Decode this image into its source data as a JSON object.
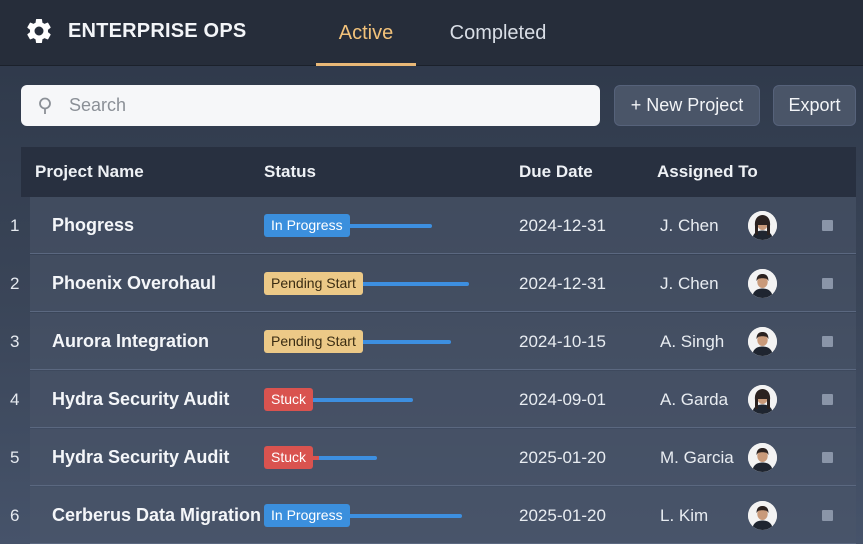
{
  "brand": {
    "title": "ENTERPRISE OPS",
    "icon": "gear-icon"
  },
  "tabs": [
    {
      "label": "Active",
      "active": true
    },
    {
      "label": "Completed",
      "active": false
    }
  ],
  "toolbar": {
    "search_placeholder": "Search",
    "new_project_label": "+ New Project",
    "export_label": "Export"
  },
  "table": {
    "columns": [
      "Project Name",
      "Status",
      "Due Date",
      "Assigned To"
    ],
    "rows": [
      {
        "num": "1",
        "name": "Phogress",
        "status": "In Progress",
        "status_kind": "progress",
        "progress": 0.7,
        "due": "2024-12-31",
        "assignee": "J. Chen",
        "avatar": "female"
      },
      {
        "num": "2",
        "name": "Phoenix Overohaul",
        "status": "Pending Start",
        "status_kind": "pending",
        "progress": 0.9,
        "due": "2024-12-31",
        "assignee": "J. Chen",
        "avatar": "male"
      },
      {
        "num": "3",
        "name": "Aurora Integration",
        "status": "Pending Start",
        "status_kind": "pending",
        "progress": 0.75,
        "due": "2024-10-15",
        "assignee": "A. Singh",
        "avatar": "male"
      },
      {
        "num": "4",
        "name": "Hydra Security Audit",
        "status": "Stuck",
        "status_kind": "stuck",
        "progress": 0.85,
        "due": "2024-09-01",
        "assignee": "A. Garda",
        "avatar": "female"
      },
      {
        "num": "5",
        "name": "Hydra Security Audit",
        "status": "Stuck",
        "status_kind": "stuck2",
        "progress": 0.55,
        "due": "2025-01-20",
        "assignee": "M. Garcia",
        "avatar": "male"
      },
      {
        "num": "6",
        "name": "Cerberus Data Migration",
        "status": "In Progress",
        "status_kind": "progress",
        "progress": 0.95,
        "due": "2025-01-20",
        "assignee": "L. Kim",
        "avatar": "male"
      }
    ]
  },
  "colors": {
    "accent": "#e9b877",
    "progress": "#3b8fdd",
    "pending": "#ecc987",
    "stuck": "#d9534f"
  }
}
